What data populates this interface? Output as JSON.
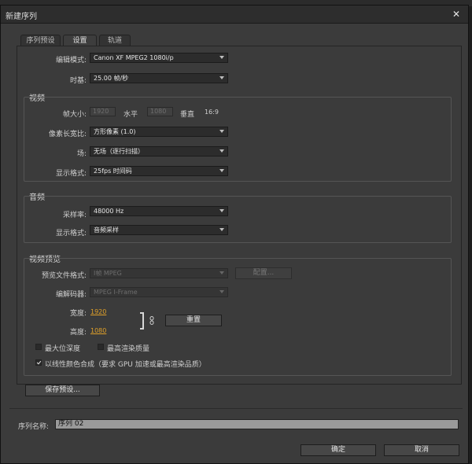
{
  "window": {
    "title": "新建序列",
    "close_label": "✕"
  },
  "tabs": [
    {
      "label": "序列预设"
    },
    {
      "label": "设置"
    },
    {
      "label": "轨道"
    }
  ],
  "settings": {
    "edit_mode_label": "编辑模式:",
    "edit_mode_value": "Canon XF MPEG2 1080i/p",
    "timebase_label": "时基:",
    "timebase_value": "25.00 帧/秒"
  },
  "video": {
    "group_label": "视频",
    "frame_size_label": "帧大小:",
    "frame_width": "1920",
    "horizontal_label": "水平",
    "frame_height": "1080",
    "vertical_label": "垂直",
    "aspect": "16:9",
    "pixel_aspect_label": "像素长宽比:",
    "pixel_aspect_value": "方形像素 (1.0)",
    "fields_label": "场:",
    "fields_value": "无场（逐行扫描）",
    "display_format_label": "显示格式:",
    "display_format_value": "25fps 时间码"
  },
  "audio": {
    "group_label": "音频",
    "sample_rate_label": "采样率:",
    "sample_rate_value": "48000 Hz",
    "display_format_label": "显示格式:",
    "display_format_value": "音频采样"
  },
  "preview": {
    "group_label": "视频预览",
    "file_format_label": "预览文件格式:",
    "file_format_value": "I帧 MPEG",
    "configure_label": "配置...",
    "codec_label": "编解码器:",
    "codec_value": "MPEG I-Frame",
    "width_label": "宽度:",
    "width_value": "1920",
    "height_label": "高度:",
    "height_value": "1080",
    "reset_label": "重置",
    "max_bit_depth_label": "最大位深度",
    "max_render_quality_label": "最高渲染质量",
    "linear_color_label": "以线性颜色合成（要求 GPU 加速或最高渲染品质）"
  },
  "save_preset_label": "保存预设...",
  "sequence_name_label": "序列名称:",
  "sequence_name_value": "序列 02",
  "ok_label": "确定",
  "cancel_label": "取消",
  "checkboxes": {
    "max_bit_depth": false,
    "max_render_quality": false,
    "linear_color": true
  }
}
